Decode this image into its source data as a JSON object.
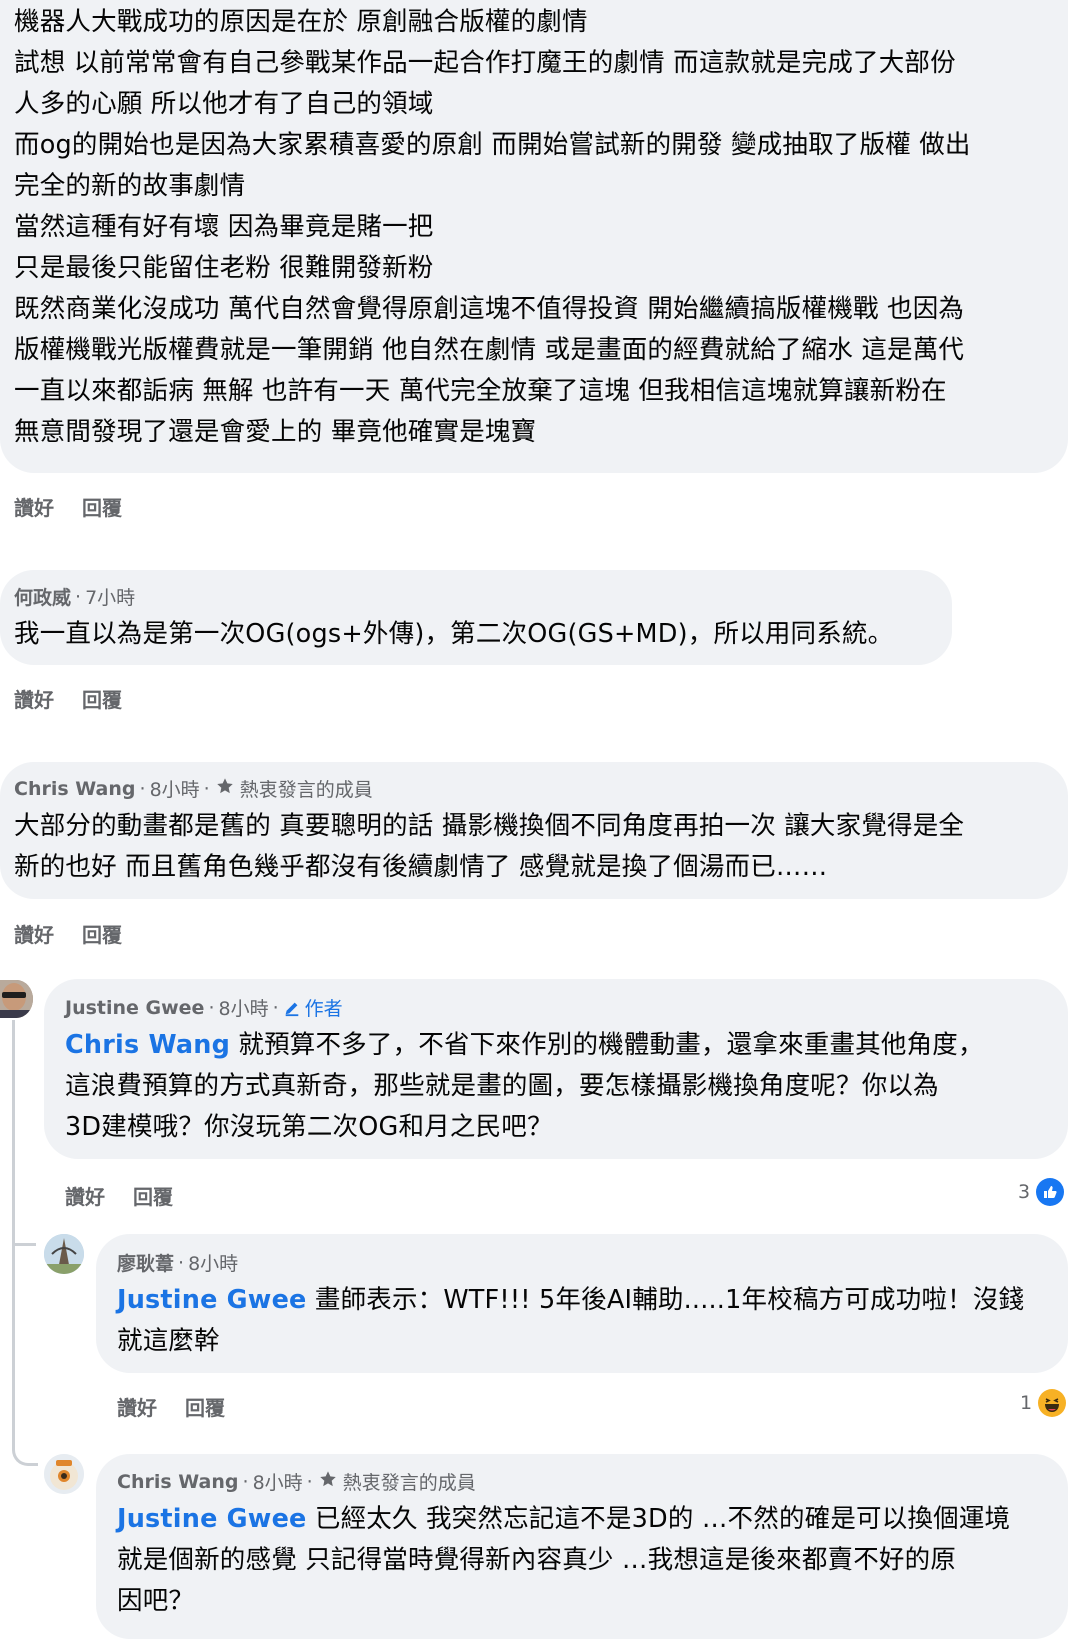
{
  "actions": {
    "like": "讚好",
    "reply": "回覆"
  },
  "badges": {
    "top_fan": "熱衷發言的成員",
    "author": "作者"
  },
  "comment1": {
    "lines": [
      "機器人大戰成功的原因是在於 原創融合版權的劇情",
      "試想 以前常常會有自己參戰某作品一起合作打魔王的劇情 而這款就是完成了大部份",
      "人多的心願 所以他才有了自己的領域",
      "而og的開始也是因為大家累積喜愛的原創 而開始嘗試新的開發 變成抽取了版權 做出",
      "完全的新的故事劇情",
      "當然這種有好有壞 因為畢竟是賭一把",
      "只是最後只能留住老粉 很難開發新粉",
      "既然商業化沒成功 萬代自然會覺得原創這塊不值得投資 開始繼續搞版權機戰 也因為",
      "版權機戰光版權費就是一筆開銷 他自然在劇情 或是畫面的經費就給了縮水 這是萬代",
      "一直以來都詬病 無解 也許有一天 萬代完全放棄了這塊 但我相信這塊就算讓新粉在",
      "無意間發現了還是會愛上的 畢竟他確實是塊寶"
    ]
  },
  "comment2": {
    "author": "何政威",
    "time": "7小時",
    "lines": [
      "我一直以為是第一次OG(ogs+外傳)，第二次OG(GS+MD)，所以用同系統。"
    ]
  },
  "comment3": {
    "author": "Chris Wang",
    "time": "8小時",
    "lines": [
      "大部分的動畫都是舊的 真要聰明的話 攝影機換個不同角度再拍一次 讓大家覺得是全",
      "新的也好  而且舊角色幾乎都沒有後續劇情了 感覺就是換了個湯而已……"
    ]
  },
  "reply1": {
    "author": "Justine Gwee",
    "time": "8小時",
    "mention": "Chris Wang",
    "line1_rest": " 就預算不多了，不省下來作別的機體動畫，還拿來重畫其他角度，",
    "lines": [
      "這浪費預算的方式真新奇，那些就是畫的圖，要怎樣攝影機換角度呢？你以為",
      "3D建模哦？你沒玩第二次OG和月之民吧？"
    ],
    "reaction_count": "3",
    "reaction_icon": "like-icon"
  },
  "reply2": {
    "author": "廖耿葦",
    "time": "8小時",
    "mention": "Justine Gwee",
    "line1_rest": " 畫師表示：WTF!!!  5年後AI輔助.....1年校稿方可成功啦！沒錢",
    "lines": [
      "就這麼幹"
    ],
    "reaction_count": "1",
    "reaction_icon": "haha-icon"
  },
  "reply3": {
    "author": "Chris Wang",
    "time": "8小時",
    "mention": "Justine Gwee",
    "line1_rest": " 已經太久 我突然忘記這不是3D的 …不然的確是可以換個運境",
    "lines": [
      "就是個新的感覺   只記得當時覺得新內容真少 …我想這是後來都賣不好的原",
      "因吧？"
    ]
  },
  "colors": {
    "bubble": "#f0f2f5",
    "mention": "#1b74e4",
    "meta": "#65676b",
    "like_blue": "#1877f2",
    "haha_yellow": "#f7b125"
  }
}
